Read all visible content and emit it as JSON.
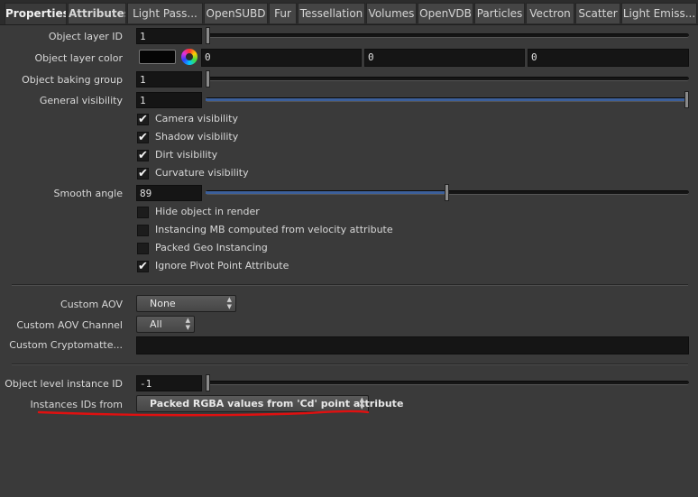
{
  "tabs": [
    "Properties",
    "Attributes",
    "Light Pass...",
    "OpenSUBD",
    "Fur",
    "Tessellation",
    "Volumes",
    "OpenVDB",
    "Particles",
    "Vectron",
    "Scatter",
    "Light Emiss..."
  ],
  "params": {
    "object_layer_id": {
      "label": "Object layer ID",
      "value": "1",
      "slider": 0.0
    },
    "object_layer_color": {
      "label": "Object layer color",
      "r": "0",
      "g": "0",
      "b": "0",
      "swatch_color": "#050505"
    },
    "object_baking_group": {
      "label": "Object baking group",
      "value": "1",
      "slider": 0.0
    },
    "general_visibility": {
      "label": "General visibility",
      "value": "1",
      "slider": 1.0
    },
    "smooth_angle": {
      "label": "Smooth angle",
      "value": "89",
      "slider": 0.4944
    }
  },
  "visibility_checks": [
    {
      "label": "Camera visibility",
      "checked": true
    },
    {
      "label": "Shadow visibility",
      "checked": true
    },
    {
      "label": "Dirt visibility",
      "checked": true
    },
    {
      "label": "Curvature visibility",
      "checked": true
    }
  ],
  "option_checks": [
    {
      "label": "Hide object in render",
      "checked": false
    },
    {
      "label": "Instancing MB computed from velocity attribute",
      "checked": false
    },
    {
      "label": "Packed Geo Instancing",
      "checked": false
    },
    {
      "label": "Ignore Pivot Point Attribute",
      "checked": true
    }
  ],
  "aov": {
    "custom_aov_label": "Custom AOV",
    "custom_aov_value": "None",
    "custom_aov_channel_label": "Custom AOV Channel",
    "custom_aov_channel_value": "All",
    "custom_crypto_label": "Custom Cryptomatte...",
    "custom_crypto_value": ""
  },
  "instance": {
    "object_level_instance_id": {
      "label": "Object level instance ID",
      "value": "-1",
      "slider": 0.0
    },
    "instance_ids_from_label": "Instances IDs from",
    "instance_ids_from_value": "Packed RGBA values from 'Cd' point attribute"
  },
  "colors": {
    "slider_fill": "#3c5f9a",
    "annotation": "#e01010"
  },
  "icons": {
    "checkmark": "✔",
    "dropdown_arrows": "▲▼",
    "color_wheel": "color-wheel-icon"
  }
}
